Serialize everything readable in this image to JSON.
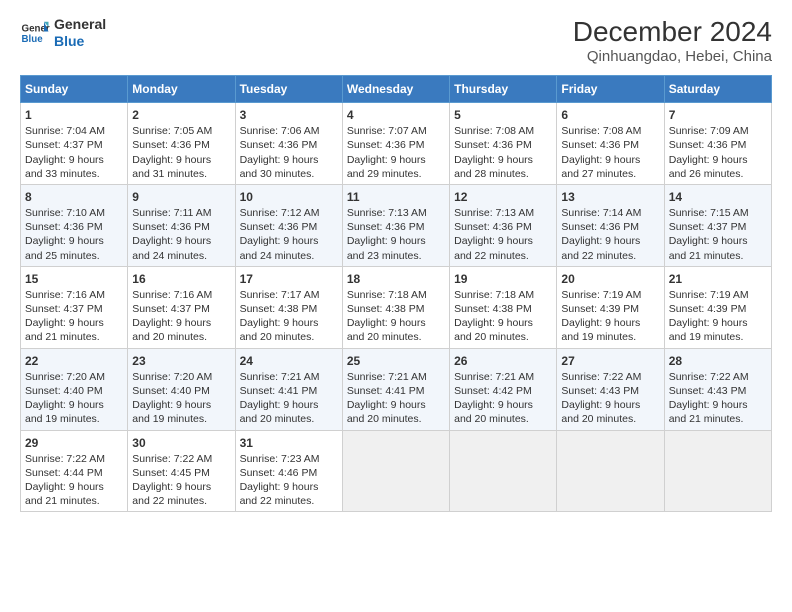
{
  "logo": {
    "line1": "General",
    "line2": "Blue"
  },
  "title": "December 2024",
  "subtitle": "Qinhuangdao, Hebei, China",
  "weekdays": [
    "Sunday",
    "Monday",
    "Tuesday",
    "Wednesday",
    "Thursday",
    "Friday",
    "Saturday"
  ],
  "weeks": [
    [
      {
        "day": "1",
        "sunrise": "7:04 AM",
        "sunset": "4:37 PM",
        "daylight": "9 hours and 33 minutes."
      },
      {
        "day": "2",
        "sunrise": "7:05 AM",
        "sunset": "4:36 PM",
        "daylight": "9 hours and 31 minutes."
      },
      {
        "day": "3",
        "sunrise": "7:06 AM",
        "sunset": "4:36 PM",
        "daylight": "9 hours and 30 minutes."
      },
      {
        "day": "4",
        "sunrise": "7:07 AM",
        "sunset": "4:36 PM",
        "daylight": "9 hours and 29 minutes."
      },
      {
        "day": "5",
        "sunrise": "7:08 AM",
        "sunset": "4:36 PM",
        "daylight": "9 hours and 28 minutes."
      },
      {
        "day": "6",
        "sunrise": "7:08 AM",
        "sunset": "4:36 PM",
        "daylight": "9 hours and 27 minutes."
      },
      {
        "day": "7",
        "sunrise": "7:09 AM",
        "sunset": "4:36 PM",
        "daylight": "9 hours and 26 minutes."
      }
    ],
    [
      {
        "day": "8",
        "sunrise": "7:10 AM",
        "sunset": "4:36 PM",
        "daylight": "9 hours and 25 minutes."
      },
      {
        "day": "9",
        "sunrise": "7:11 AM",
        "sunset": "4:36 PM",
        "daylight": "9 hours and 24 minutes."
      },
      {
        "day": "10",
        "sunrise": "7:12 AM",
        "sunset": "4:36 PM",
        "daylight": "9 hours and 24 minutes."
      },
      {
        "day": "11",
        "sunrise": "7:13 AM",
        "sunset": "4:36 PM",
        "daylight": "9 hours and 23 minutes."
      },
      {
        "day": "12",
        "sunrise": "7:13 AM",
        "sunset": "4:36 PM",
        "daylight": "9 hours and 22 minutes."
      },
      {
        "day": "13",
        "sunrise": "7:14 AM",
        "sunset": "4:36 PM",
        "daylight": "9 hours and 22 minutes."
      },
      {
        "day": "14",
        "sunrise": "7:15 AM",
        "sunset": "4:37 PM",
        "daylight": "9 hours and 21 minutes."
      }
    ],
    [
      {
        "day": "15",
        "sunrise": "7:16 AM",
        "sunset": "4:37 PM",
        "daylight": "9 hours and 21 minutes."
      },
      {
        "day": "16",
        "sunrise": "7:16 AM",
        "sunset": "4:37 PM",
        "daylight": "9 hours and 20 minutes."
      },
      {
        "day": "17",
        "sunrise": "7:17 AM",
        "sunset": "4:38 PM",
        "daylight": "9 hours and 20 minutes."
      },
      {
        "day": "18",
        "sunrise": "7:18 AM",
        "sunset": "4:38 PM",
        "daylight": "9 hours and 20 minutes."
      },
      {
        "day": "19",
        "sunrise": "7:18 AM",
        "sunset": "4:38 PM",
        "daylight": "9 hours and 20 minutes."
      },
      {
        "day": "20",
        "sunrise": "7:19 AM",
        "sunset": "4:39 PM",
        "daylight": "9 hours and 19 minutes."
      },
      {
        "day": "21",
        "sunrise": "7:19 AM",
        "sunset": "4:39 PM",
        "daylight": "9 hours and 19 minutes."
      }
    ],
    [
      {
        "day": "22",
        "sunrise": "7:20 AM",
        "sunset": "4:40 PM",
        "daylight": "9 hours and 19 minutes."
      },
      {
        "day": "23",
        "sunrise": "7:20 AM",
        "sunset": "4:40 PM",
        "daylight": "9 hours and 19 minutes."
      },
      {
        "day": "24",
        "sunrise": "7:21 AM",
        "sunset": "4:41 PM",
        "daylight": "9 hours and 20 minutes."
      },
      {
        "day": "25",
        "sunrise": "7:21 AM",
        "sunset": "4:41 PM",
        "daylight": "9 hours and 20 minutes."
      },
      {
        "day": "26",
        "sunrise": "7:21 AM",
        "sunset": "4:42 PM",
        "daylight": "9 hours and 20 minutes."
      },
      {
        "day": "27",
        "sunrise": "7:22 AM",
        "sunset": "4:43 PM",
        "daylight": "9 hours and 20 minutes."
      },
      {
        "day": "28",
        "sunrise": "7:22 AM",
        "sunset": "4:43 PM",
        "daylight": "9 hours and 21 minutes."
      }
    ],
    [
      {
        "day": "29",
        "sunrise": "7:22 AM",
        "sunset": "4:44 PM",
        "daylight": "9 hours and 21 minutes."
      },
      {
        "day": "30",
        "sunrise": "7:22 AM",
        "sunset": "4:45 PM",
        "daylight": "9 hours and 22 minutes."
      },
      {
        "day": "31",
        "sunrise": "7:23 AM",
        "sunset": "4:46 PM",
        "daylight": "9 hours and 22 minutes."
      },
      null,
      null,
      null,
      null
    ]
  ],
  "labels": {
    "sunrise": "Sunrise:",
    "sunset": "Sunset:",
    "daylight": "Daylight:"
  }
}
